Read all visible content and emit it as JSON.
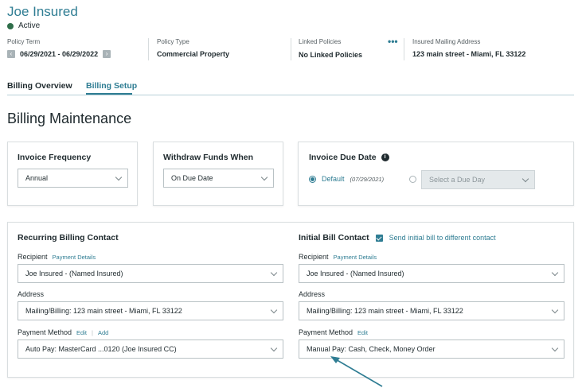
{
  "header": {
    "insured_name": "Joe Insured",
    "status": "Active",
    "policy_term_label": "Policy Term",
    "policy_term_value": "06/29/2021 - 06/29/2022",
    "policy_type_label": "Policy Type",
    "policy_type_value": "Commercial Property",
    "linked_policies_label": "Linked Policies",
    "linked_policies_more": "•••",
    "linked_policies_value": "No Linked Policies",
    "mailing_address_label": "Insured Mailing Address",
    "mailing_address_value": "123 main street - Miami, FL 33122"
  },
  "tabs": [
    {
      "label": "Billing Overview",
      "active": false
    },
    {
      "label": "Billing Setup",
      "active": true
    }
  ],
  "section_title": "Billing Maintenance",
  "invoice_frequency": {
    "title": "Invoice Frequency",
    "value": "Annual"
  },
  "withdraw_funds": {
    "title": "Withdraw Funds When",
    "value": "On Due Date"
  },
  "invoice_due_date": {
    "title": "Invoice Due Date",
    "info": "i",
    "default_label": "Default",
    "default_date": "(07/29/2021)",
    "select_placeholder": "Select a Due Day"
  },
  "recurring_contact": {
    "title": "Recurring Billing Contact",
    "recipient_label": "Recipient",
    "recipient_link": "Payment Details",
    "recipient_value": "Joe Insured - (Named Insured)",
    "address_label": "Address",
    "address_value": "Mailing/Billing: 123 main street  - Miami, FL 33122",
    "payment_label": "Payment Method",
    "payment_edit": "Edit",
    "payment_sep": "|",
    "payment_add": "Add",
    "payment_value": "Auto Pay: MasterCard  ...0120 (Joe Insured CC)"
  },
  "initial_contact": {
    "title": "Initial Bill Contact",
    "checkbox_label": "Send initial bill to different contact",
    "recipient_label": "Recipient",
    "recipient_link": "Payment Details",
    "recipient_value": "Joe Insured - (Named Insured)",
    "address_label": "Address",
    "address_value": "Mailing/Billing: 123 main street  - Miami, FL 33122",
    "payment_label": "Payment Method",
    "payment_edit": "Edit",
    "payment_value": "Manual Pay: Cash, Check, Money Order"
  },
  "colors": {
    "accent": "#2f7d93",
    "status_active": "#2f6e4a",
    "text": "#1f2a2e"
  }
}
